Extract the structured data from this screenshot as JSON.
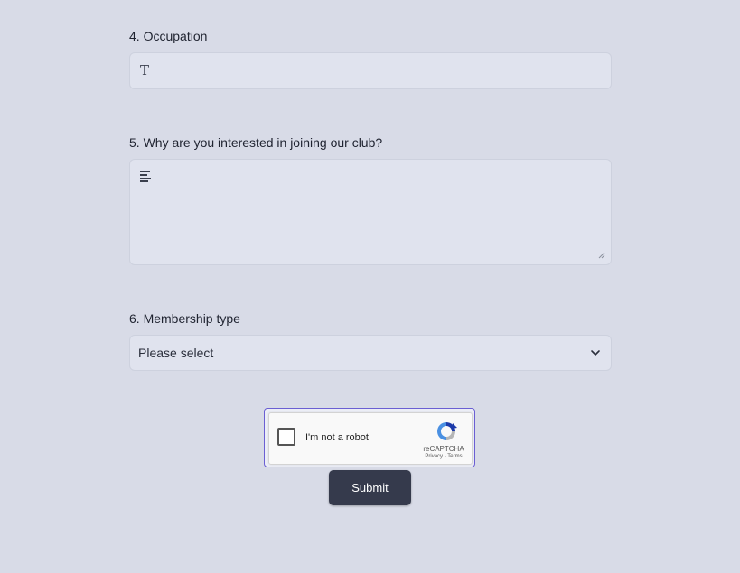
{
  "form": {
    "occupation": {
      "label": "4. Occupation",
      "icon": "text-type-icon",
      "value": ""
    },
    "interest": {
      "label": "5. Why are you interested in joining our club?",
      "icon": "paragraph-lines-icon",
      "value": ""
    },
    "membership": {
      "label": "6. Membership type",
      "selected": "Please select"
    }
  },
  "captcha": {
    "label": "I'm not a robot",
    "brand": "reCAPTCHA",
    "links": "Privacy - Terms"
  },
  "submit_label": "Submit",
  "colors": {
    "background": "#d8dbe7",
    "field": "#e0e3ee",
    "button": "#353a4c",
    "focus_ring": "#6b5fd3"
  }
}
